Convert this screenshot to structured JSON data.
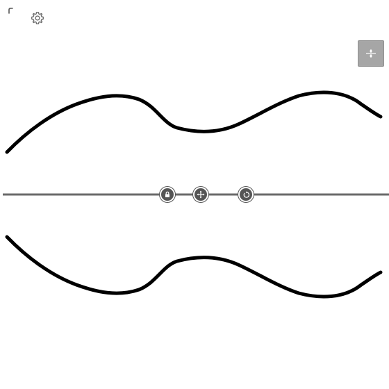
{
  "icons": {
    "corner": "brush-corner-icon",
    "settings": "gear-icon",
    "symmetry_toggle": "symmetry-icon",
    "lock": "lock-icon",
    "move": "move-arrows-icon",
    "rotate": "rotate-icon"
  },
  "colors": {
    "stroke": "#000000",
    "axis": "#6a6a6a",
    "control_fill": "#555555",
    "toggle_bg": "#a6a6a6"
  }
}
